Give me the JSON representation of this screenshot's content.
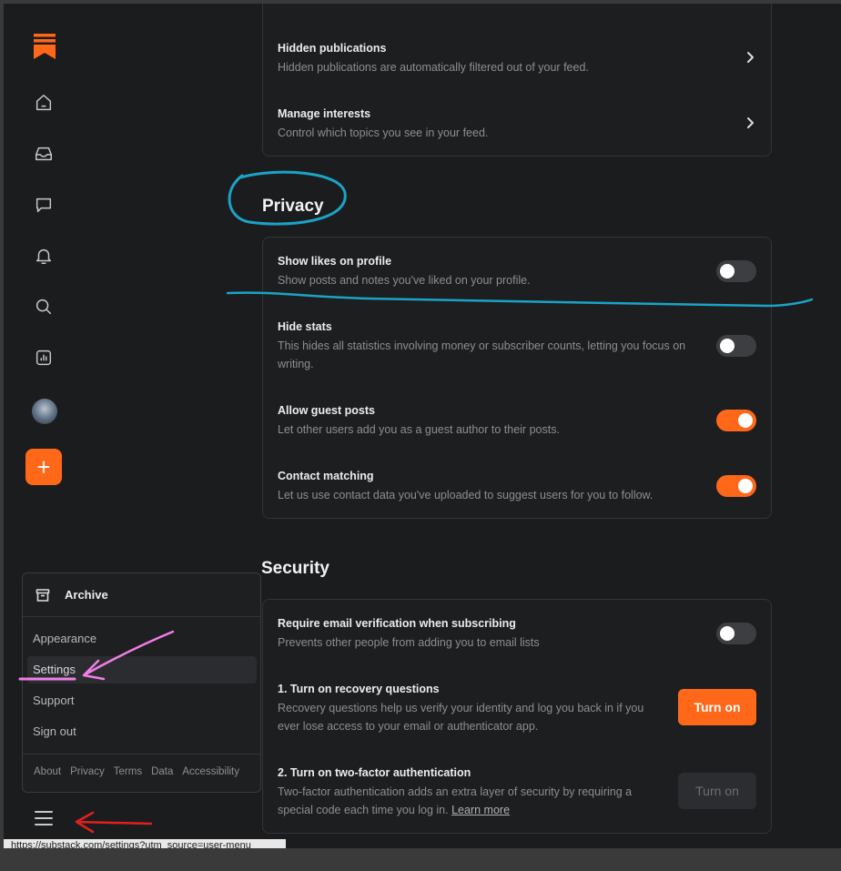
{
  "status_url": "https://substack.com/settings?utm_source=user-menu",
  "colors": {
    "accent": "#ff6719",
    "background": "#1b1c1e",
    "annotation_blue": "#1ba3c6",
    "annotation_pink": "#f07ee6",
    "annotation_red": "#e02020"
  },
  "nav": {
    "icons": [
      "substack-logo-icon",
      "home-icon",
      "inbox-icon",
      "chat-icon",
      "bell-icon",
      "search-icon",
      "stats-icon",
      "avatar-icon",
      "plus-icon"
    ]
  },
  "menu": {
    "archive_label": "Archive",
    "items": [
      {
        "label": "Appearance"
      },
      {
        "label": "Settings"
      },
      {
        "label": "Support"
      },
      {
        "label": "Sign out"
      }
    ],
    "footer_links": [
      "About",
      "Privacy",
      "Terms",
      "Data",
      "Accessibility"
    ]
  },
  "feed": {
    "rows": [
      {
        "title": "Hidden publications",
        "desc": "Hidden publications are automatically filtered out of your feed."
      },
      {
        "title": "Manage interests",
        "desc": "Control which topics you see in your feed."
      }
    ]
  },
  "privacy": {
    "heading": "Privacy",
    "rows": [
      {
        "title": "Show likes on profile",
        "desc": "Show posts and notes you've liked on your profile.",
        "enabled": false
      },
      {
        "title": "Hide stats",
        "desc": "This hides all statistics involving money or subscriber counts, letting you focus on writing.",
        "enabled": false
      },
      {
        "title": "Allow guest posts",
        "desc": "Let other users add you as a guest author to their posts.",
        "enabled": true
      },
      {
        "title": "Contact matching",
        "desc": "Let us use contact data you've uploaded to suggest users for you to follow.",
        "enabled": true
      }
    ]
  },
  "security": {
    "heading": "Security",
    "rows": [
      {
        "title": "Require email verification when subscribing",
        "desc": "Prevents other people from adding you to email lists",
        "enabled": false
      },
      {
        "title": "1. Turn on recovery questions",
        "desc": "Recovery questions help us verify your identity and log you back in if you ever lose access to your email or authenticator app.",
        "button": "Turn on"
      },
      {
        "title": "2. Turn on two-factor authentication",
        "desc": "Two-factor authentication adds an extra layer of security by requiring a special code each time you log in.",
        "link": "Learn more",
        "button": "Turn on"
      }
    ]
  }
}
